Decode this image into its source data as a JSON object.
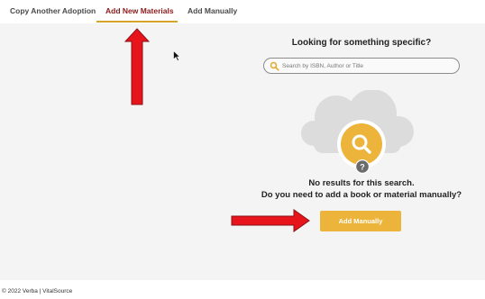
{
  "tabs": [
    {
      "label": "Copy Another Adoption",
      "active": false
    },
    {
      "label": "Add New Materials",
      "active": true
    },
    {
      "label": "Add Manually",
      "active": false
    }
  ],
  "search": {
    "heading": "Looking for something specific?",
    "placeholder": "Search by ISBN, Author or Title",
    "value": ""
  },
  "empty_state": {
    "line1": "No results for this search.",
    "line2": "Do you need to add a book or material manually?",
    "illustration_icons": [
      "cloud-icon",
      "magnifier-icon",
      "question-icon"
    ]
  },
  "actions": {
    "add_manually_label": "Add Manually"
  },
  "footer": {
    "text": "© 2022 Verba | VitalSource"
  },
  "annotations": [
    "red-arrow-up-icon",
    "red-arrow-right-icon"
  ],
  "colors": {
    "active_tab_text": "#8b1a1a",
    "tab_underline": "#d4a32a",
    "accent": "#ecb43a",
    "annotation_red": "#e8141c",
    "background": "#f4f4f4"
  }
}
